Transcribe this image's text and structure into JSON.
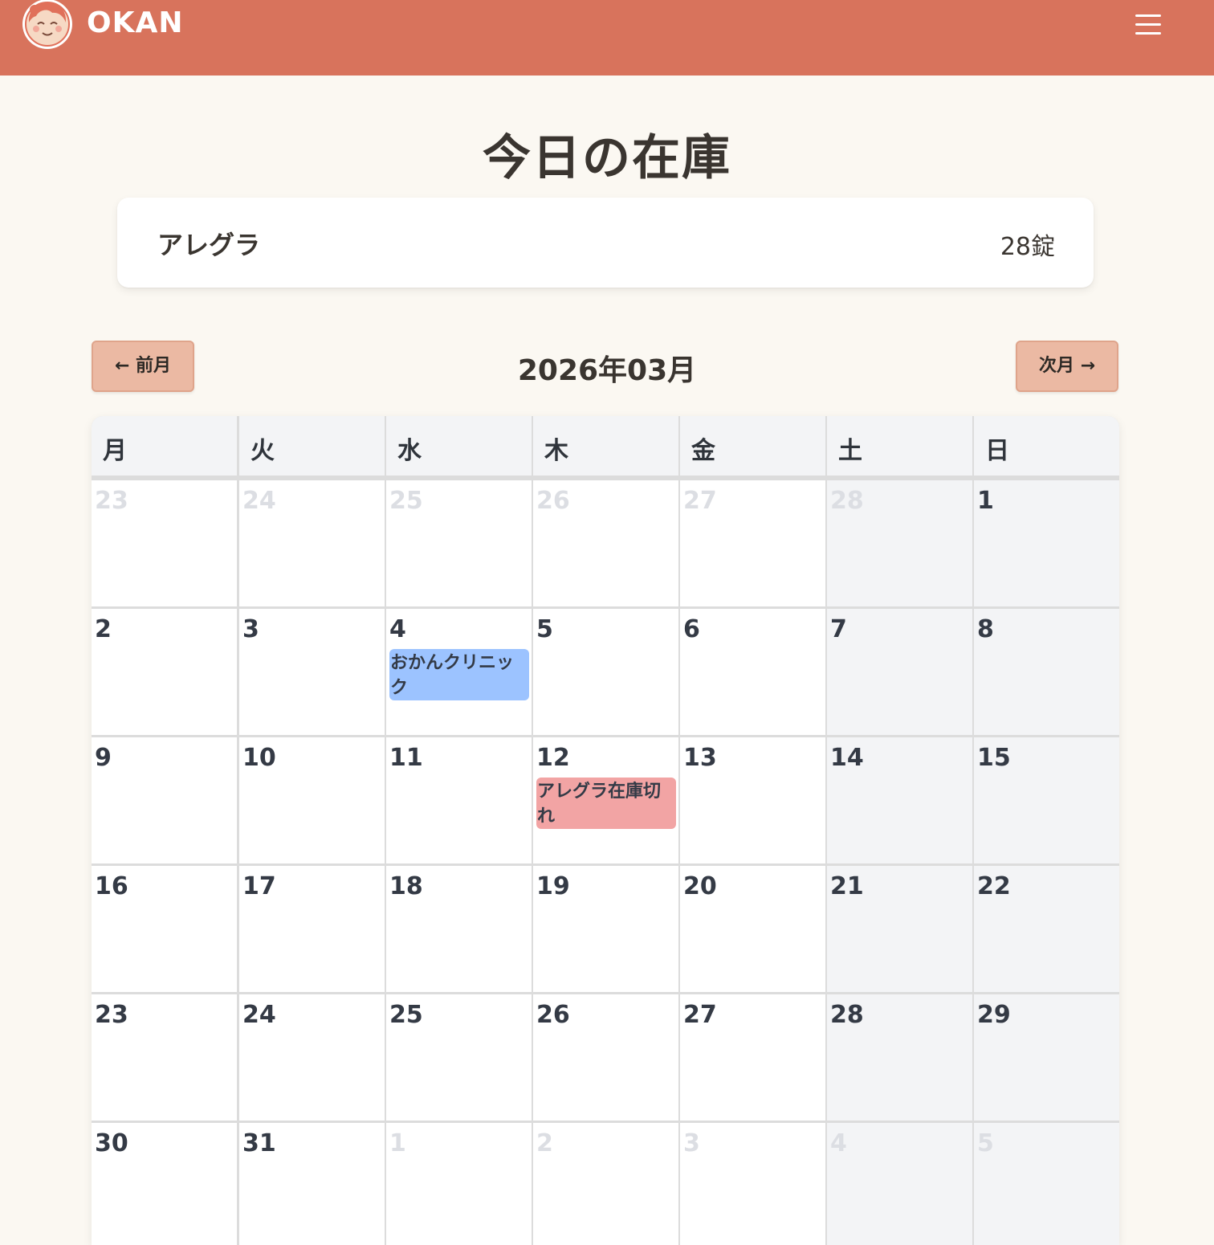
{
  "header": {
    "brand": "OKAN",
    "colors": {
      "header_bg": "#D8735C",
      "page_bg": "#FBF8F2"
    }
  },
  "page": {
    "title": "今日の在庫"
  },
  "stock": [
    {
      "name": "アレグラ",
      "quantity": "28錠"
    }
  ],
  "calendar": {
    "prev_label": "← 前月",
    "next_label": "次月 →",
    "month_label": "2026年03月",
    "weekdays": [
      "月",
      "火",
      "水",
      "木",
      "金",
      "土",
      "日"
    ],
    "weeks": [
      [
        {
          "day": "23",
          "other": true
        },
        {
          "day": "24",
          "other": true
        },
        {
          "day": "25",
          "other": true
        },
        {
          "day": "26",
          "other": true
        },
        {
          "day": "27",
          "other": true
        },
        {
          "day": "28",
          "other": true
        },
        {
          "day": "1",
          "other": false
        }
      ],
      [
        {
          "day": "2"
        },
        {
          "day": "3"
        },
        {
          "day": "4",
          "event": {
            "label": "おかんクリニック",
            "color": "#9CC3FF"
          }
        },
        {
          "day": "5"
        },
        {
          "day": "6"
        },
        {
          "day": "7"
        },
        {
          "day": "8"
        }
      ],
      [
        {
          "day": "9"
        },
        {
          "day": "10"
        },
        {
          "day": "11"
        },
        {
          "day": "12",
          "event": {
            "label": "アレグラ在庫切れ",
            "color": "#F2A4A4"
          }
        },
        {
          "day": "13"
        },
        {
          "day": "14"
        },
        {
          "day": "15"
        }
      ],
      [
        {
          "day": "16"
        },
        {
          "day": "17"
        },
        {
          "day": "18"
        },
        {
          "day": "19"
        },
        {
          "day": "20"
        },
        {
          "day": "21"
        },
        {
          "day": "22"
        }
      ],
      [
        {
          "day": "23"
        },
        {
          "day": "24"
        },
        {
          "day": "25"
        },
        {
          "day": "26"
        },
        {
          "day": "27"
        },
        {
          "day": "28"
        },
        {
          "day": "29"
        }
      ],
      [
        {
          "day": "30"
        },
        {
          "day": "31"
        },
        {
          "day": "1",
          "other": true
        },
        {
          "day": "2",
          "other": true
        },
        {
          "day": "3",
          "other": true
        },
        {
          "day": "4",
          "other": true
        },
        {
          "day": "5",
          "other": true
        }
      ]
    ]
  }
}
